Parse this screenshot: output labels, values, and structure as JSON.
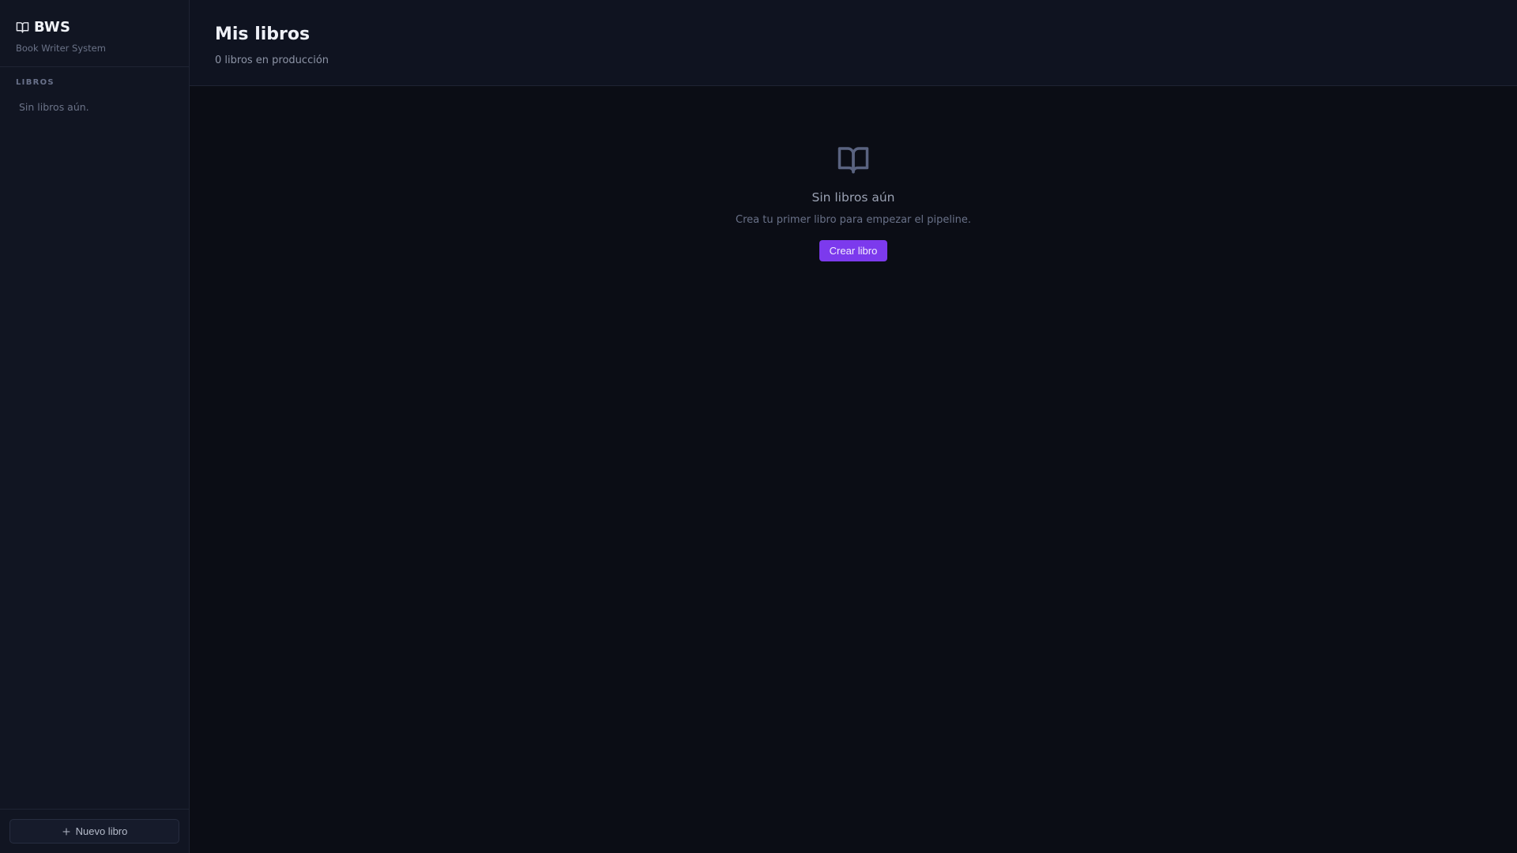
{
  "sidebar": {
    "brand": {
      "name": "BWS",
      "subtitle": "Book Writer System",
      "icon": "book-open-icon"
    },
    "section_label": "LIBROS",
    "empty_text": "Sin libros aún.",
    "footer_button": {
      "label": "Nuevo libro",
      "icon": "plus-icon"
    }
  },
  "header": {
    "title": "Mis libros",
    "subtitle": "0 libros en producción"
  },
  "empty_state": {
    "icon": "book-open-icon",
    "title": "Sin libros aún",
    "description": "Crea tu primer libro para empezar el pipeline.",
    "button_label": "Crear libro"
  },
  "colors": {
    "accent": "#7c3aed",
    "background": "#0b0d15",
    "sidebar": "#111522"
  }
}
